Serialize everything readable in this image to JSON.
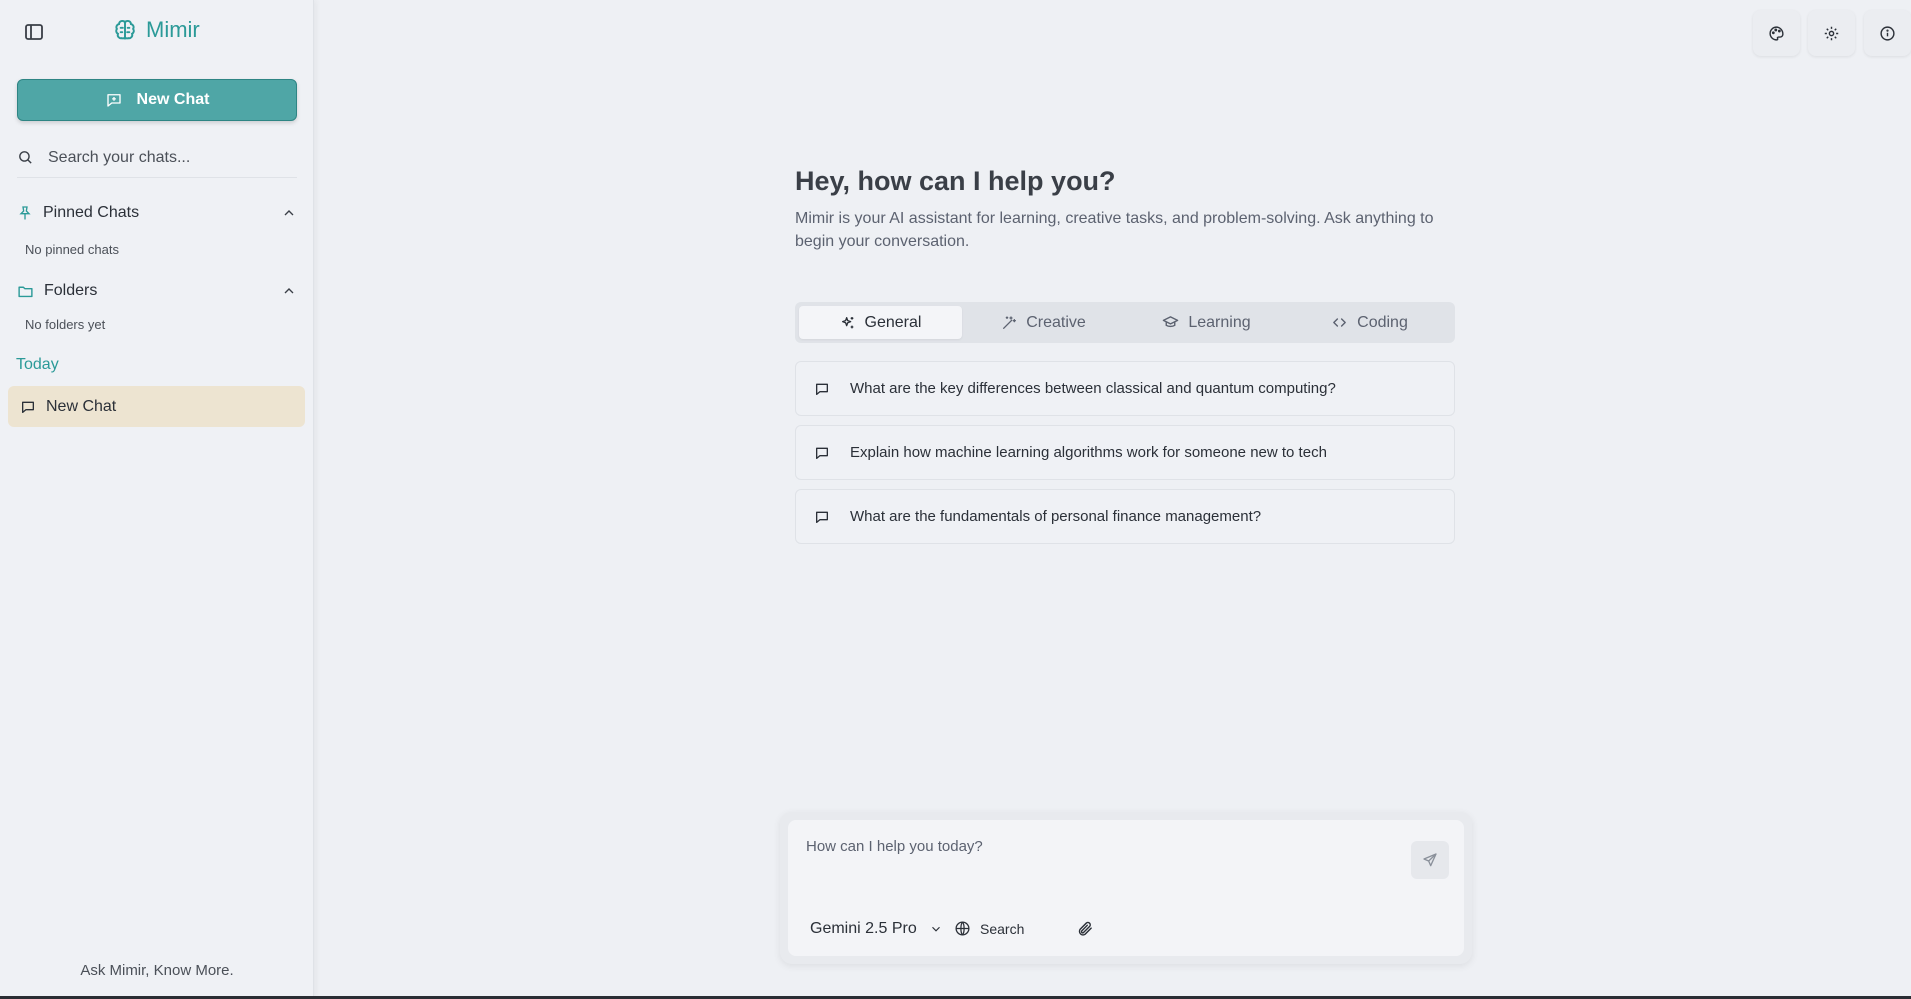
{
  "app": {
    "name": "Mimir",
    "tagline": "Ask Mimir, Know More."
  },
  "sidebar": {
    "new_chat_label": "New Chat",
    "search_placeholder": "Search your chats...",
    "pinned": {
      "label": "Pinned Chats",
      "empty": "No pinned chats"
    },
    "folders": {
      "label": "Folders",
      "empty": "No folders yet"
    },
    "today_label": "Today",
    "chats": [
      {
        "label": "New Chat"
      }
    ]
  },
  "main": {
    "greeting": "Hey, how can I help you?",
    "subtitle": "Mimir is your AI assistant for learning, creative tasks, and problem-solving. Ask anything to begin your conversation.",
    "tabs": [
      {
        "label": "General",
        "icon": "sparkles-icon",
        "active": true
      },
      {
        "label": "Creative",
        "icon": "wand-icon",
        "active": false
      },
      {
        "label": "Learning",
        "icon": "graduation-cap-icon",
        "active": false
      },
      {
        "label": "Coding",
        "icon": "code-icon",
        "active": false
      }
    ],
    "prompts": [
      "What are the key differences between classical and quantum computing?",
      "Explain how machine learning algorithms work for someone new to tech",
      "What are the fundamentals of personal finance management?"
    ]
  },
  "composer": {
    "placeholder": "How can I help you today?",
    "model": "Gemini 2.5 Pro",
    "search_label": "Search"
  },
  "top_buttons": [
    "palette-icon",
    "gear-icon",
    "info-icon"
  ],
  "colors": {
    "accent": "#2b9a98",
    "button": "#4fa6a6",
    "active_chat": "#ede4d1",
    "background": "#eef0f4"
  }
}
